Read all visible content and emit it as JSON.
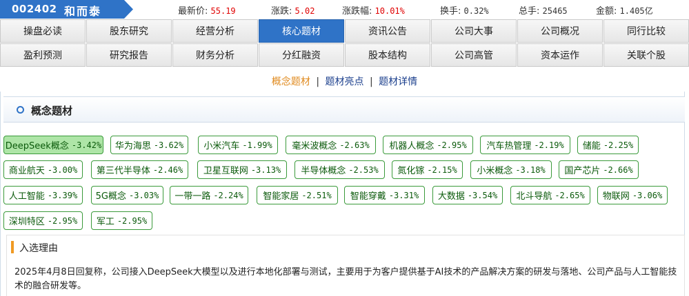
{
  "stock": {
    "code": "002402",
    "name": "和而泰"
  },
  "quotes": [
    {
      "label": "最新价:",
      "value": "55.19",
      "color": "red"
    },
    {
      "label": "涨跌:",
      "value": "5.02",
      "color": "red"
    },
    {
      "label": "涨跌幅:",
      "value": "10.01%",
      "color": "red"
    },
    {
      "label": "换手:",
      "value": "0.32%",
      "color": "normal"
    },
    {
      "label": "总手:",
      "value": "25465",
      "color": "normal"
    },
    {
      "label": "金额:",
      "value": "1.405亿",
      "color": "normal"
    }
  ],
  "nav": {
    "row1": [
      "操盘必读",
      "股东研究",
      "经营分析",
      "核心题材",
      "资讯公告",
      "公司大事",
      "公司概况",
      "同行比较"
    ],
    "row2": [
      "盈利预测",
      "研究报告",
      "财务分析",
      "分红融资",
      "股本结构",
      "公司高管",
      "资本运作",
      "关联个股"
    ],
    "active": "核心题材"
  },
  "sublinks": {
    "items": [
      "概念题材",
      "题材亮点",
      "题材详情"
    ],
    "current": "概念题材",
    "separator": "|"
  },
  "section": {
    "title": "概念题材"
  },
  "concepts": [
    {
      "name": "DeepSeek概念",
      "change": "-3.42%",
      "selected": true
    },
    {
      "name": "华为海思",
      "change": "-3.62%"
    },
    {
      "name": "小米汽车",
      "change": "-1.99%"
    },
    {
      "name": "毫米波概念",
      "change": "-2.63%"
    },
    {
      "name": "机器人概念",
      "change": "-2.95%"
    },
    {
      "name": "汽车热管理",
      "change": "-2.19%"
    },
    {
      "name": "储能",
      "change": "-2.25%"
    },
    {
      "name": "商业航天",
      "change": "-3.00%"
    },
    {
      "name": "第三代半导体",
      "change": "-2.46%"
    },
    {
      "name": "卫星互联网",
      "change": "-3.13%"
    },
    {
      "name": "半导体概念",
      "change": "-2.53%"
    },
    {
      "name": "氮化镓",
      "change": "-2.15%"
    },
    {
      "name": "小米概念",
      "change": "-3.18%"
    },
    {
      "name": "国产芯片",
      "change": "-2.66%"
    },
    {
      "name": "人工智能",
      "change": "-3.39%"
    },
    {
      "name": "5G概念",
      "change": "-3.03%"
    },
    {
      "name": "一带一路",
      "change": "-2.24%"
    },
    {
      "name": "智能家居",
      "change": "-2.51%"
    },
    {
      "name": "智能穿戴",
      "change": "-3.31%"
    },
    {
      "name": "大数据",
      "change": "-3.54%"
    },
    {
      "name": "北斗导航",
      "change": "-2.65%"
    },
    {
      "name": "物联网",
      "change": "-3.06%"
    },
    {
      "name": "深圳特区",
      "change": "-2.95%"
    },
    {
      "name": "军工",
      "change": "-2.95%"
    }
  ],
  "reason": {
    "title": "入选理由",
    "text": "2025年4月8日回复称，公司接入DeepSeek大模型以及进行本地化部署与测试，主要用于为客户提供基于AI技术的产品解决方案的研发与落地、公司产品与人工智能技术的融合研发等。"
  },
  "colors": {
    "accent": "#2f73c7",
    "up": "#e00000",
    "tag_border": "#3a9a3a",
    "tag_selected": "#aee5a7",
    "highlight_link": "#e08a1e"
  },
  "icons": {
    "section_marker": "circle-icon",
    "reason_marker": "orange-bar-icon"
  }
}
